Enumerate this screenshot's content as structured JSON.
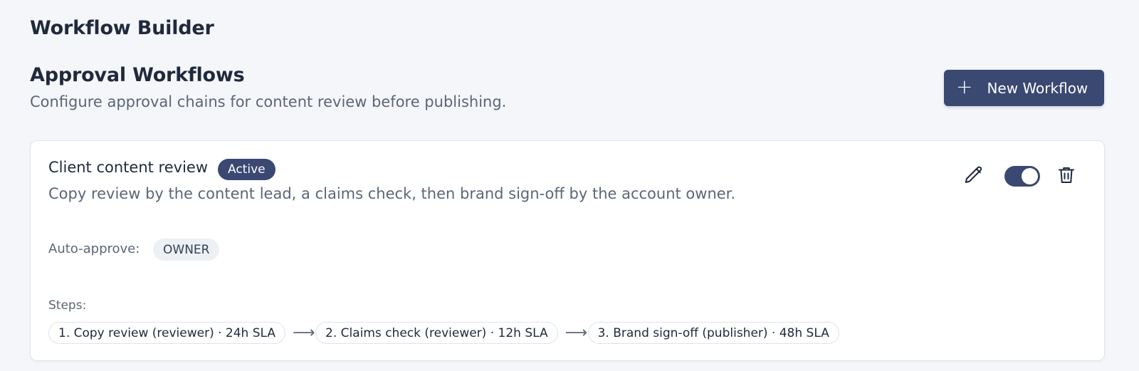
{
  "app": {
    "title": "Workflow Builder"
  },
  "section": {
    "title": "Approval Workflows",
    "subtitle": "Configure approval chains for content review before publishing."
  },
  "toolbar": {
    "new_workflow_label": "New Workflow",
    "new_workflow_icon": "plus-icon"
  },
  "workflow": {
    "name": "Client content review",
    "status": "Active",
    "enabled": true,
    "description": "Copy review by the content lead, a claims check, then brand sign-off by the account owner.",
    "auto_approve_label": "Auto-approve:",
    "auto_approve_role": "OWNER",
    "steps_label": "Steps:",
    "steps": [
      {
        "label": "1. Copy review (reviewer) · 24h SLA"
      },
      {
        "label": "2. Claims check (reviewer) · 12h SLA"
      },
      {
        "label": "3. Brand sign-off (publisher) · 48h SLA"
      }
    ],
    "arrow": "⟶"
  },
  "colors": {
    "accent": "#3a4872",
    "background": "#f5f6fa",
    "card": "#ffffff",
    "muted_text": "#5b6676",
    "chip_bg": "#edf0f4"
  }
}
